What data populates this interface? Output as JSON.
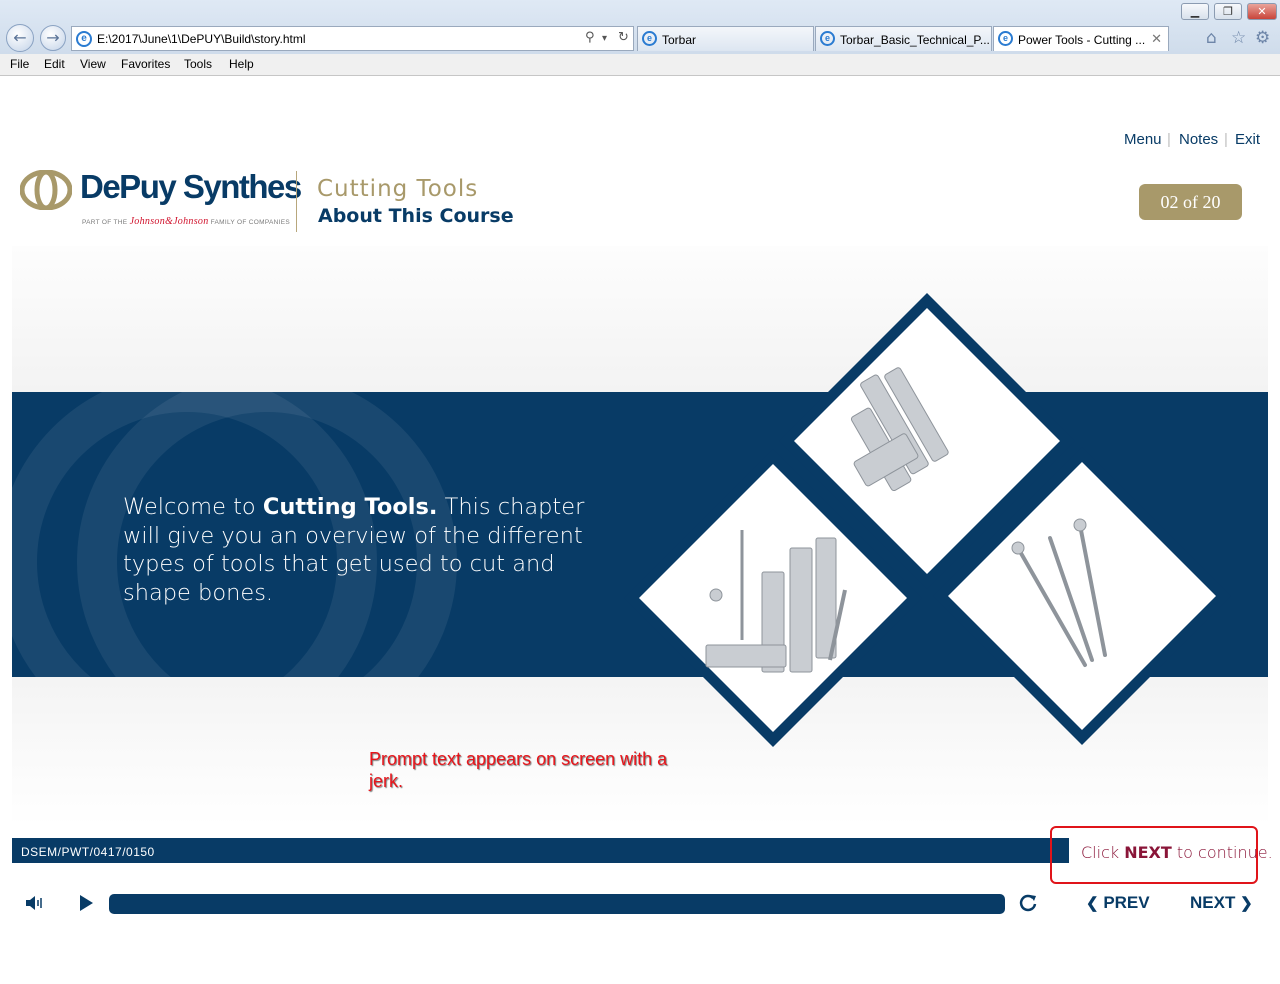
{
  "browser": {
    "window_controls": [
      "minimize",
      "restore",
      "close"
    ],
    "back_icon": "back-arrow-icon",
    "forward_icon": "forward-arrow-icon",
    "address": "E:\\2017\\June\\1\\DePUY\\Build\\story.html",
    "tabs": [
      {
        "label": "Torbar",
        "active": false
      },
      {
        "label": "Torbar_Basic_Technical_P...",
        "active": false
      },
      {
        "label": "Power Tools - Cutting ...",
        "active": true
      }
    ],
    "menu": [
      "File",
      "Edit",
      "View",
      "Favorites",
      "Tools",
      "Help"
    ]
  },
  "header": {
    "brand": "DePuy Synthes",
    "brand_sub_prefix": "PART OF THE",
    "brand_sub_jj": "Johnson&Johnson",
    "brand_sub_suffix": "FAMILY OF COMPANIES",
    "course_title": "Cutting Tools",
    "course_subtitle": "About This Course",
    "links": [
      "Menu",
      "Notes",
      "Exit"
    ],
    "page_counter": "02 of 20"
  },
  "slide": {
    "welcome_pre": "Welcome to ",
    "welcome_bold": "Cutting Tools.",
    "welcome_post": " This chapter will give you an overview of the different types of tools that get used to cut and shape bones.",
    "images": [
      "saw-blades-image",
      "osteotomes-image",
      "drill-bits-image"
    ]
  },
  "annotation": {
    "prompt_note": "Prompt text appears on screen with a jerk."
  },
  "footer": {
    "code": "DSEM/PWT/0417/0150",
    "hint_pre": "Click ",
    "hint_bold": "NEXT",
    "hint_post": " to continue."
  },
  "player": {
    "prev_label": "PREV",
    "next_label": "NEXT",
    "progress": 0
  },
  "colors": {
    "navy": "#083b66",
    "gold": "#a8996a",
    "annotation_red": "#e0141a",
    "hint_maroon": "#8a1538"
  }
}
